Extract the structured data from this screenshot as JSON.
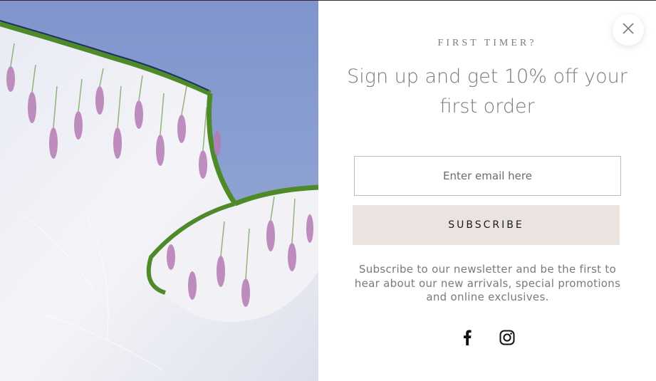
{
  "popup": {
    "eyebrow": "FIRST TIMER?",
    "headline": "Sign up and get 10% off your first order",
    "email_placeholder": "Enter email here",
    "subscribe_label": "SUBSCRIBE",
    "blurb": "Subscribe to our newsletter and be the first to hear about our new arrivals, special promotions and online exclusives.",
    "social": [
      {
        "icon": "facebook-icon"
      },
      {
        "icon": "instagram-icon"
      }
    ],
    "close_icon": "close-icon"
  },
  "image": {
    "description_icon": "lavender-scarf-image"
  },
  "colors": {
    "sky": "#8a9ed3",
    "scarf": "#eef0f6",
    "trim_green": "#4f8a2a",
    "trim_navy": "#1f2f66",
    "lavender": "#b57bb4",
    "text_grey": "#7a7a7a",
    "button_bg": "#ebe3df"
  }
}
